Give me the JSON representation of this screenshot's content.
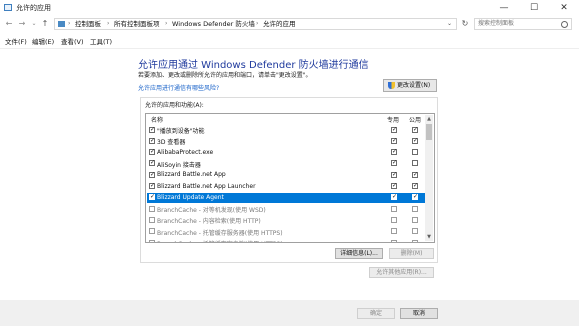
{
  "window": {
    "title": "允许的应用"
  },
  "nav": {
    "breadcrumbs": [
      "控制面板",
      "所有控制面板项",
      "Windows Defender 防火墙",
      "允许的应用"
    ],
    "search_placeholder": "搜索控制面板"
  },
  "menu": [
    "文件(F)",
    "编辑(E)",
    "查看(V)",
    "工具(T)"
  ],
  "main": {
    "heading": "允许应用通过 Windows Defender 防火墙进行通信",
    "description": "若要添加、更改或删除所允许的应用和端口，请单击\"更改设置\"。",
    "risk_link": "允许应用进行通信有哪些风险?",
    "change_settings_label": "更改设置(N)",
    "group_label": "允许的应用和功能(A):",
    "columns": {
      "name": "名称",
      "private": "专用",
      "public": "公用"
    },
    "rows": [
      {
        "name": "\"播放到设备\"功能",
        "enabled": true,
        "private": true,
        "public": true,
        "selected": false
      },
      {
        "name": "3D 查看器",
        "enabled": true,
        "private": true,
        "public": true,
        "selected": false
      },
      {
        "name": "AlibabaProtect.exe",
        "enabled": true,
        "private": true,
        "public": false,
        "selected": false
      },
      {
        "name": "AliSoyin 接击器",
        "enabled": true,
        "private": true,
        "public": false,
        "selected": false
      },
      {
        "name": "Blizzard Battle.net App",
        "enabled": true,
        "private": true,
        "public": true,
        "selected": false
      },
      {
        "name": "Blizzard Battle.net App Launcher",
        "enabled": true,
        "private": true,
        "public": true,
        "selected": false
      },
      {
        "name": "Blizzard Update Agent",
        "enabled": true,
        "private": true,
        "public": true,
        "selected": true
      },
      {
        "name": "BranchCache - 对等机发现(使用 WSD)",
        "enabled": false,
        "private": false,
        "public": false,
        "selected": false
      },
      {
        "name": "BranchCache - 内容检索(使用 HTTP)",
        "enabled": false,
        "private": false,
        "public": false,
        "selected": false
      },
      {
        "name": "BranchCache - 托管缓存服务器(使用 HTTPS)",
        "enabled": false,
        "private": false,
        "public": false,
        "selected": false
      },
      {
        "name": "BranchCache - 托管缓存客户端(使用 HTTPS)",
        "enabled": false,
        "private": false,
        "public": false,
        "selected": false
      }
    ],
    "details_label": "详细信息(L)...",
    "delete_label": "删除(M)",
    "allow_other_label": "允许其他应用(R)..."
  },
  "footer": {
    "ok_label": "确定",
    "cancel_label": "取消"
  }
}
